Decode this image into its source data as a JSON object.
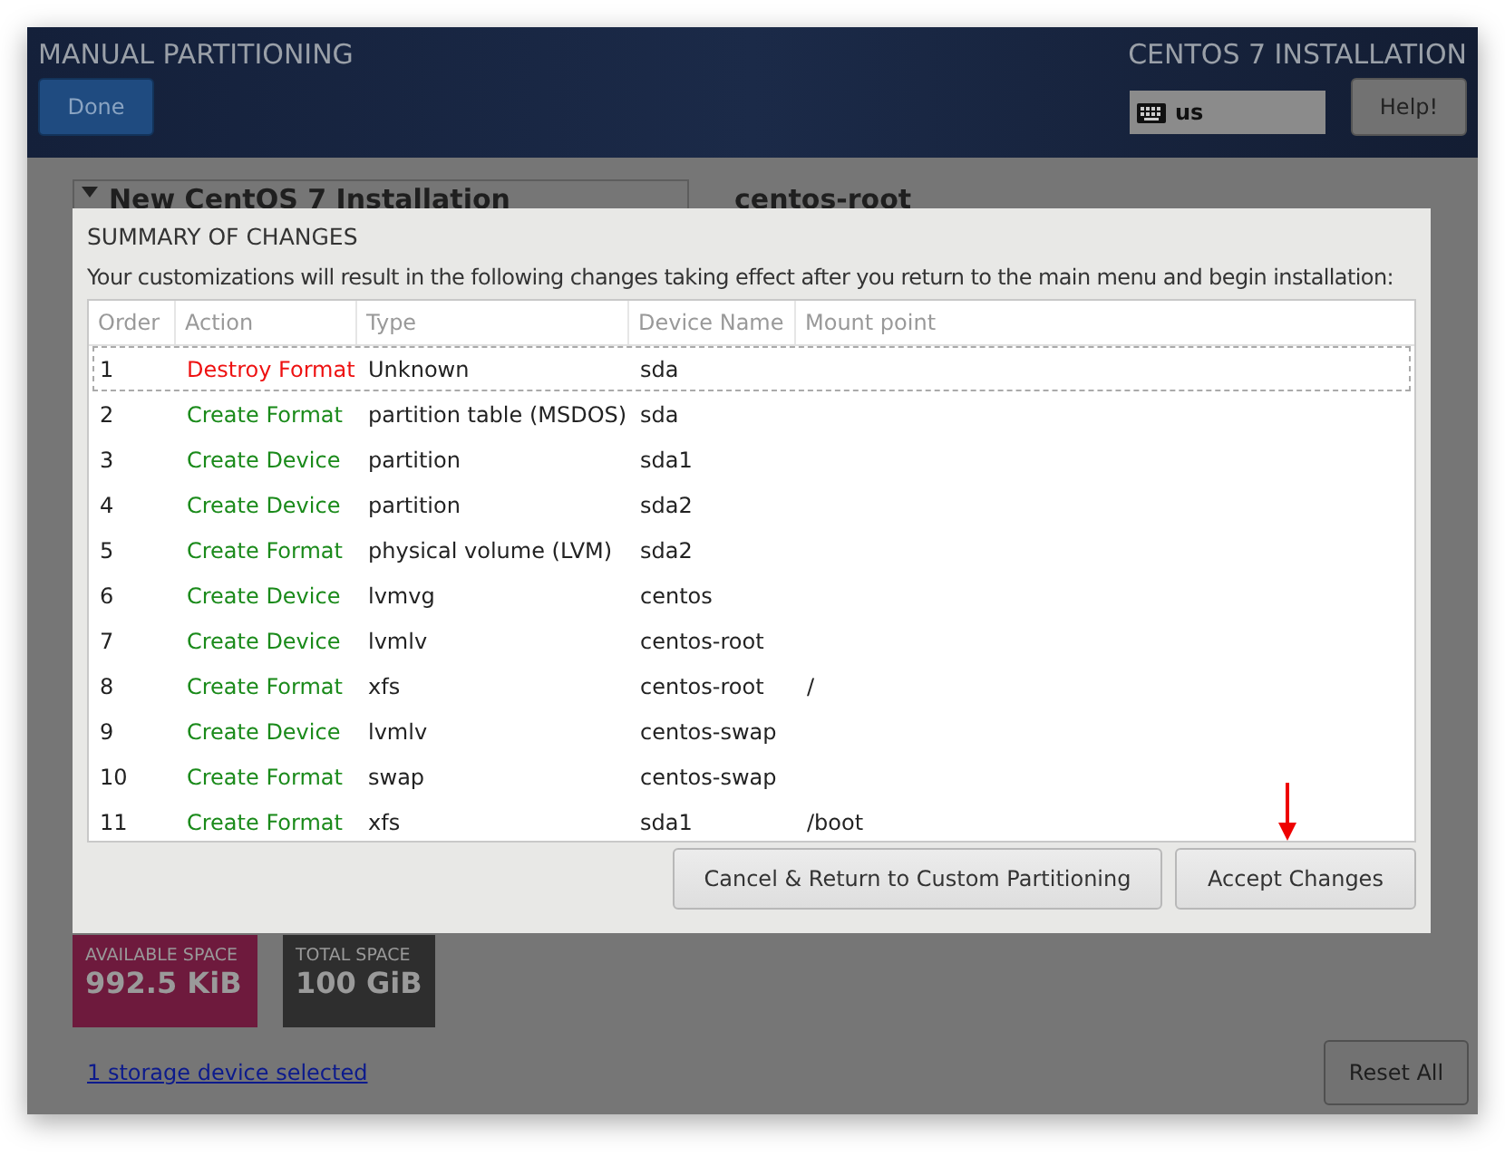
{
  "header": {
    "title": "MANUAL PARTITIONING",
    "done_button": "Done",
    "product": "CENTOS 7 INSTALLATION",
    "keyboard_layout": "us",
    "help_button": "Help!"
  },
  "background": {
    "installation_heading": "New CentOS 7 Installation",
    "selected_device": "centos-root",
    "available_space": {
      "label": "AVAILABLE SPACE",
      "value": "992.5 KiB"
    },
    "total_space": {
      "label": "TOTAL SPACE",
      "value": "100 GiB"
    },
    "storage_link": "1 storage device selected",
    "reset_button": "Reset All"
  },
  "dialog": {
    "title": "SUMMARY OF CHANGES",
    "description": "Your customizations will result in the following changes taking effect after you return to the main menu and begin installation:",
    "columns": [
      "Order",
      "Action",
      "Type",
      "Device Name",
      "Mount point"
    ],
    "rows": [
      {
        "order": "1",
        "action": "Destroy Format",
        "kind": "destroy",
        "type": "Unknown",
        "device": "sda",
        "mount": "",
        "selected": true
      },
      {
        "order": "2",
        "action": "Create Format",
        "kind": "create",
        "type": "partition table (MSDOS)",
        "device": "sda",
        "mount": "",
        "selected": false
      },
      {
        "order": "3",
        "action": "Create Device",
        "kind": "create",
        "type": "partition",
        "device": "sda1",
        "mount": "",
        "selected": false
      },
      {
        "order": "4",
        "action": "Create Device",
        "kind": "create",
        "type": "partition",
        "device": "sda2",
        "mount": "",
        "selected": false
      },
      {
        "order": "5",
        "action": "Create Format",
        "kind": "create",
        "type": "physical volume (LVM)",
        "device": "sda2",
        "mount": "",
        "selected": false
      },
      {
        "order": "6",
        "action": "Create Device",
        "kind": "create",
        "type": "lvmvg",
        "device": "centos",
        "mount": "",
        "selected": false
      },
      {
        "order": "7",
        "action": "Create Device",
        "kind": "create",
        "type": "lvmlv",
        "device": "centos-root",
        "mount": "",
        "selected": false
      },
      {
        "order": "8",
        "action": "Create Format",
        "kind": "create",
        "type": "xfs",
        "device": "centos-root",
        "mount": "/",
        "selected": false
      },
      {
        "order": "9",
        "action": "Create Device",
        "kind": "create",
        "type": "lvmlv",
        "device": "centos-swap",
        "mount": "",
        "selected": false
      },
      {
        "order": "10",
        "action": "Create Format",
        "kind": "create",
        "type": "swap",
        "device": "centos-swap",
        "mount": "",
        "selected": false
      },
      {
        "order": "11",
        "action": "Create Format",
        "kind": "create",
        "type": "xfs",
        "device": "sda1",
        "mount": "/boot",
        "selected": false
      }
    ],
    "cancel_button": "Cancel & Return to Custom Partitioning",
    "accept_button": "Accept Changes"
  }
}
